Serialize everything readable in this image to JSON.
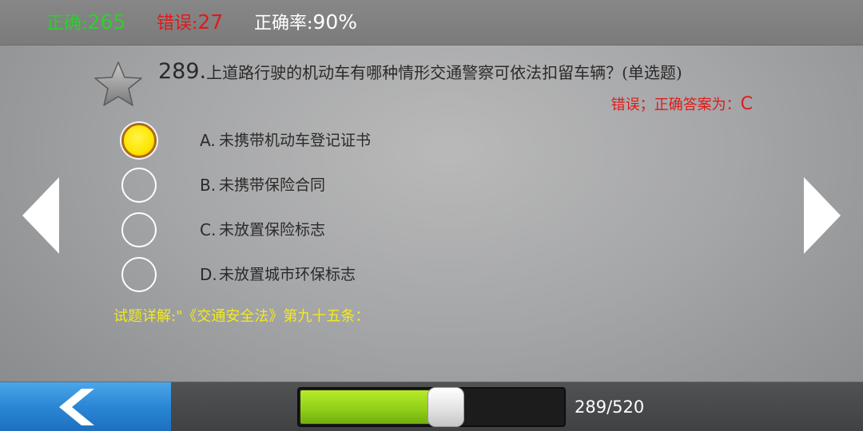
{
  "stats": {
    "correct_label": "正确:",
    "correct_value": "265",
    "wrong_label": "错误:",
    "wrong_value": "27",
    "rate_label": "正确率:",
    "rate_value": "90%"
  },
  "question": {
    "number": "289.",
    "text": "上道路行驶的机动车有哪种情形交通警察可依法扣留车辆？(单选题)",
    "answer_label": "错误；正确答案为：",
    "answer_value": "C"
  },
  "options": [
    {
      "letter": "A.",
      "text": "未携带机动车登记证书",
      "selected": true
    },
    {
      "letter": "B.",
      "text": "未携带保险合同",
      "selected": false
    },
    {
      "letter": "C.",
      "text": "未放置保险标志",
      "selected": false
    },
    {
      "letter": "D.",
      "text": "未放置城市环保标志",
      "selected": false
    }
  ],
  "explanation": "试题详解:\"《交通安全法》第九十五条：",
  "progress": {
    "current": 289,
    "total": 520,
    "label": "289/520"
  },
  "icons": {
    "favorite": "star-icon",
    "prev": "chevron-left-icon",
    "next": "chevron-right-icon",
    "back": "back-arrow-icon"
  },
  "colors": {
    "correct": "#29d12b",
    "wrong": "#e01a1a",
    "explanation": "#f2ea1c",
    "progress_fill": "#92d019",
    "back_button": "#2a86d4"
  }
}
